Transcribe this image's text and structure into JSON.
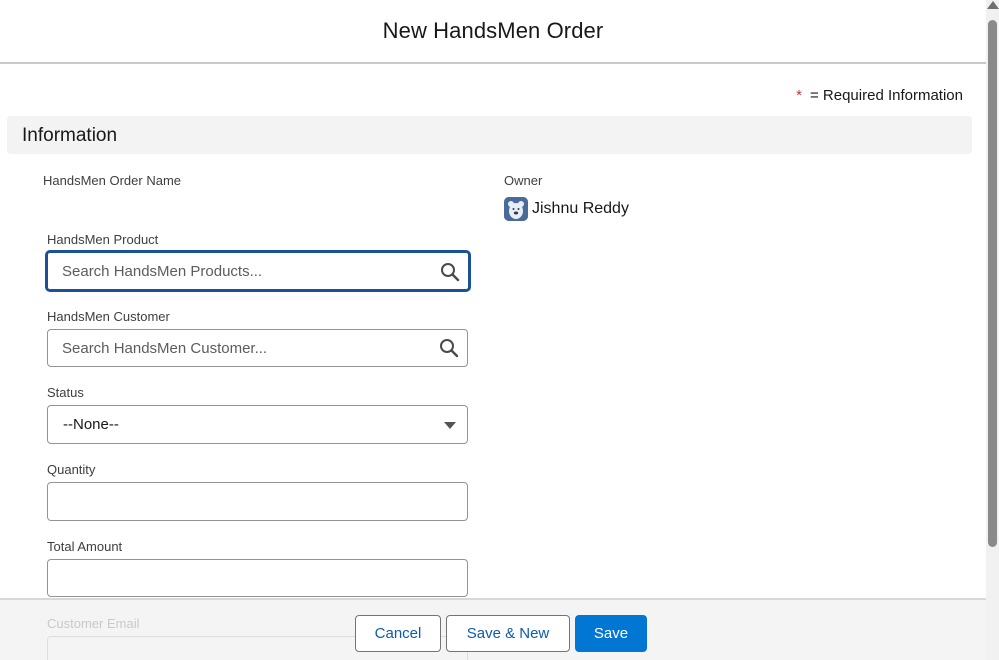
{
  "modal": {
    "title": "New HandsMen Order",
    "required_star": "*",
    "required_text": "= Required Information",
    "section_title": "Information"
  },
  "fields": {
    "order_name_label": "HandsMen Order Name",
    "owner_label": "Owner",
    "owner_name": "Jishnu Reddy",
    "product_label": "HandsMen Product",
    "product_placeholder": "Search HandsMen Products...",
    "customer_label": "HandsMen Customer",
    "customer_placeholder": "Search HandsMen Customer...",
    "status_label": "Status",
    "status_value": "--None--",
    "quantity_label": "Quantity",
    "quantity_value": "",
    "total_amount_label": "Total Amount",
    "total_amount_value": "",
    "customer_email_label": "Customer Email"
  },
  "footer": {
    "cancel_label": "Cancel",
    "save_new_label": "Save & New",
    "save_label": "Save"
  },
  "icons": {
    "search": "search-icon",
    "caret": "chevron-down-icon",
    "avatar": "avatar"
  },
  "colors": {
    "brand": "#0176d3",
    "focus_border": "#1b5297",
    "required_star": "#c23934"
  }
}
